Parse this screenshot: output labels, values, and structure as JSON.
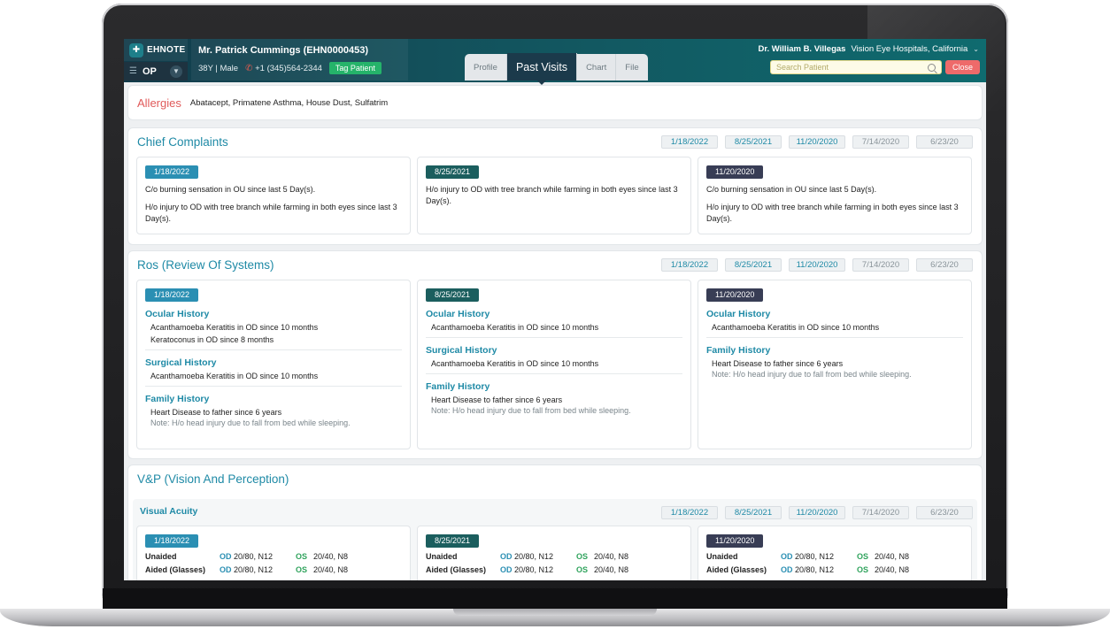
{
  "app": {
    "brand": "EHNOTE",
    "mode": "OP"
  },
  "patient": {
    "name": "Mr. Patrick Cummings",
    "id": "(EHN0000453)",
    "demographics": "38Y | Male",
    "phone": "+1 (345)564-2344",
    "tag_label": "Tag Patient"
  },
  "tabs": [
    {
      "label": "Profile"
    },
    {
      "label": "Past Visits"
    },
    {
      "label": "Chart"
    },
    {
      "label": "File"
    }
  ],
  "doctor": {
    "name": "Dr. William B. Villegas",
    "hospital": "Vision Eye Hospitals, California"
  },
  "search": {
    "placeholder": "Search Patient"
  },
  "close_label": "Close",
  "dates": [
    "1/18/2022",
    "8/25/2021",
    "11/20/2020",
    "7/14/2020",
    "6/23/20"
  ],
  "allergies": {
    "title": "Allergies",
    "text": "Abatacept, Primatene Asthma, House Dust, Sulfatrim"
  },
  "chief_complaints": {
    "title": "Chief Complaints",
    "visits": [
      {
        "date": "1/18/2022",
        "lines": [
          "C/o burning sensation in OU since last 5 Day(s).",
          "H/o injury to OD with tree branch while farming in both eyes since last 3 Day(s)."
        ]
      },
      {
        "date": "8/25/2021",
        "lines": [
          "H/o injury to OD with tree branch while farming in both eyes since last 3 Day(s)."
        ]
      },
      {
        "date": "11/20/2020",
        "lines": [
          "C/o burning sensation in OU since last 5 Day(s).",
          "H/o injury to OD with tree branch while farming in both eyes since last 3 Day(s)."
        ]
      }
    ]
  },
  "ros": {
    "title": "Ros (Review Of Systems)",
    "headings": {
      "ocular": "Ocular History",
      "surgical": "Surgical History",
      "family": "Family History"
    },
    "v1": {
      "date": "1/18/2022",
      "ocular1": "Acanthamoeba Keratitis in OD since 10 months",
      "ocular2": "Keratoconus in OD since 8 months",
      "surgical1": "Acanthamoeba Keratitis in OD since 10 months",
      "family1": "Heart Disease to father since 6 years",
      "note": "Note: H/o head injury due to fall from bed while sleeping."
    },
    "v2": {
      "date": "8/25/2021",
      "ocular1": "Acanthamoeba Keratitis in OD since 10 months",
      "surgical1": "Acanthamoeba Keratitis in OD since 10 months",
      "family1": "Heart Disease to father since 6 years",
      "note": "Note: H/o head injury due to fall from bed while sleeping."
    },
    "v3": {
      "date": "11/20/2020",
      "ocular1": "Acanthamoeba Keratitis in OD since 10 months",
      "family1": "Heart Disease to father since 6 years",
      "note": "Note: H/o head injury due to fall from bed while sleeping."
    }
  },
  "vp": {
    "title": "V&P (Vision And Perception)",
    "subtitle": "Visual Acuity",
    "labels": {
      "unaided": "Unaided",
      "aided": "Aided (Glasses)",
      "od": "OD",
      "os": "OS"
    },
    "visits": [
      {
        "date": "1/18/2022",
        "unaided_od": "20/80, N12",
        "unaided_os": "20/40, N8",
        "aided_od": "20/80, N12",
        "aided_os": "20/40, N8"
      },
      {
        "date": "8/25/2021",
        "unaided_od": "20/80, N12",
        "unaided_os": "20/40, N8",
        "aided_od": "20/80, N12",
        "aided_os": "20/40, N8"
      },
      {
        "date": "11/20/2020",
        "unaided_od": "20/80, N12",
        "unaided_os": "20/40, N8",
        "aided_od": "20/80, N12",
        "aided_os": "20/40, N8"
      }
    ]
  }
}
